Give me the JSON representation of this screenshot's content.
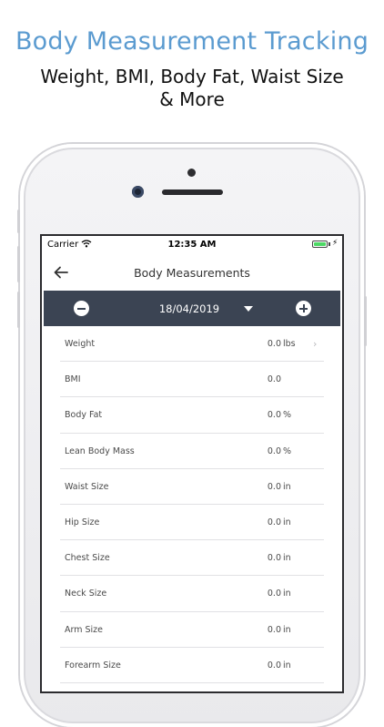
{
  "promo": {
    "title": "Body Measurement Tracking",
    "subtitle": "Weight, BMI, Body Fat, Waist Size & More"
  },
  "status_bar": {
    "carrier": "Carrier",
    "time": "12:35 AM",
    "battery_level": 1.0,
    "battery_color": "#4cd964"
  },
  "nav": {
    "title": "Body Measurements",
    "back_icon": "arrow-left-icon"
  },
  "date_bar": {
    "date": "18/04/2019",
    "background": "#3b4453",
    "prev_icon": "minus-circle-icon",
    "next_icon": "plus-circle-icon",
    "dropdown_icon": "triangle-down-icon"
  },
  "measurements": [
    {
      "label": "Weight",
      "value": "0.0",
      "unit": "lbs",
      "chevron": "›"
    },
    {
      "label": "BMI",
      "value": "0.0",
      "unit": "",
      "chevron": ""
    },
    {
      "label": "Body Fat",
      "value": "0.0",
      "unit": "%",
      "chevron": ""
    },
    {
      "label": "Lean Body Mass",
      "value": "0.0",
      "unit": "%",
      "chevron": ""
    },
    {
      "label": "Waist Size",
      "value": "0.0",
      "unit": "in",
      "chevron": ""
    },
    {
      "label": "Hip Size",
      "value": "0.0",
      "unit": "in",
      "chevron": ""
    },
    {
      "label": "Chest Size",
      "value": "0.0",
      "unit": "in",
      "chevron": ""
    },
    {
      "label": "Neck Size",
      "value": "0.0",
      "unit": "in",
      "chevron": ""
    },
    {
      "label": "Arm Size",
      "value": "0.0",
      "unit": "in",
      "chevron": ""
    },
    {
      "label": "Forearm Size",
      "value": "0.0",
      "unit": "in",
      "chevron": ""
    }
  ],
  "colors": {
    "promo_title": "#5b9bd0",
    "accent_dark": "#3b4453"
  }
}
